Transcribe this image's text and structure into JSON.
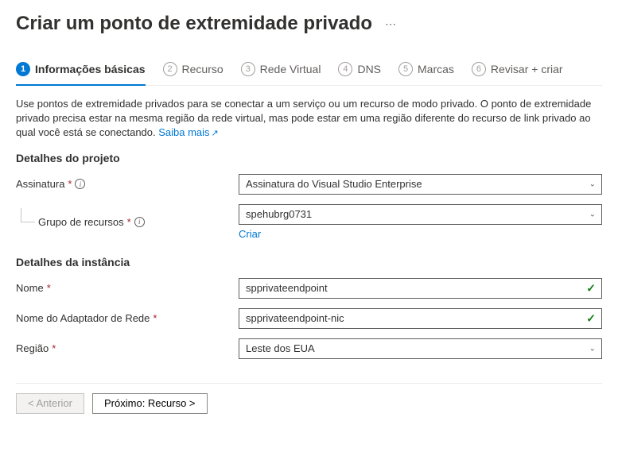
{
  "header": {
    "title": "Criar um ponto de extremidade privado"
  },
  "tabs": [
    {
      "num": "1",
      "label": "Informações básicas"
    },
    {
      "num": "2",
      "label": "Recurso"
    },
    {
      "num": "3",
      "label": "Rede Virtual"
    },
    {
      "num": "4",
      "label": "DNS"
    },
    {
      "num": "5",
      "label": "Marcas"
    },
    {
      "num": "6",
      "label": "Revisar + criar"
    }
  ],
  "intro": {
    "text": "Use pontos de extremidade privados para se conectar a um serviço ou um recurso de modo privado. O ponto de extremidade privado precisa estar na mesma região da rede virtual, mas pode estar em uma região diferente do recurso de link privado ao qual você está se conectando. ",
    "learn_more": "Saiba mais"
  },
  "project": {
    "section_title": "Detalhes do projeto",
    "subscription_label": "Assinatura",
    "subscription_value": "Assinatura do Visual Studio Enterprise",
    "rg_label": "Grupo de recursos",
    "rg_value": "spehubrg0731",
    "create_new": "Criar"
  },
  "instance": {
    "section_title": "Detalhes da instância",
    "name_label": "Nome",
    "name_value": "spprivateendpoint",
    "nic_label": "Nome do Adaptador de Rede",
    "nic_value": "spprivateendpoint-nic",
    "region_label": "Região",
    "region_value": "Leste dos EUA"
  },
  "footer": {
    "previous": "< Anterior",
    "next": "Próximo: Recurso >"
  }
}
